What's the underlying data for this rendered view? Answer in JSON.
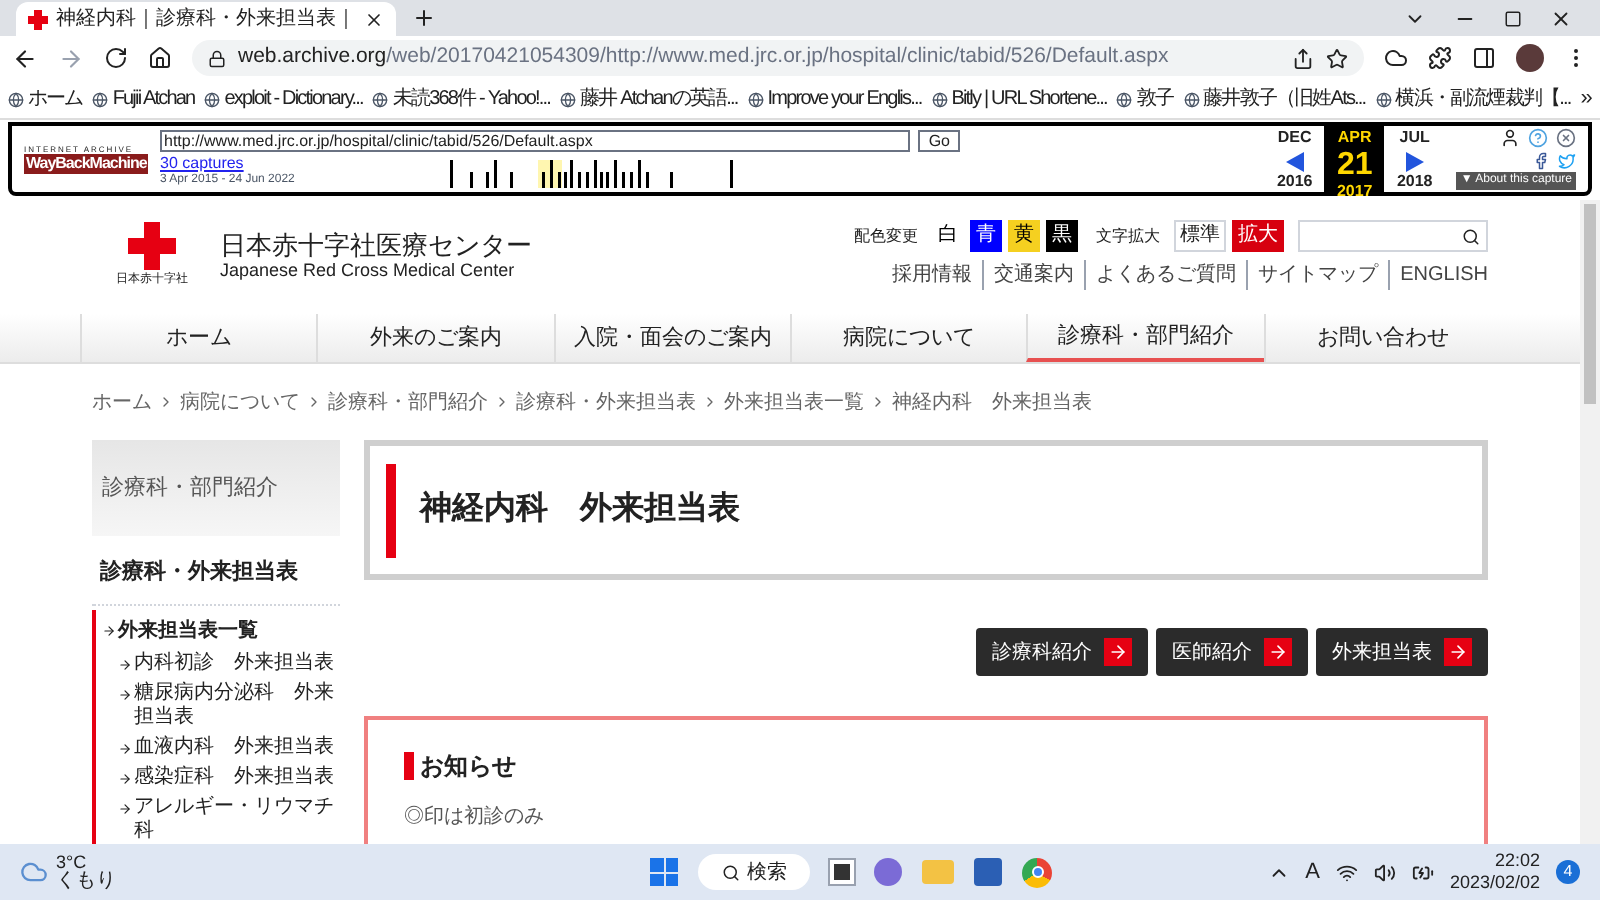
{
  "browser": {
    "tab_title": "神経内科｜診療科・外来担当表｜",
    "url_host": "web.archive.org",
    "url_path": "/web/20170421054309/http://www.med.jrc.or.jp/hospital/clinic/tabid/526/Default.aspx",
    "bookmarks": [
      "ホーム",
      "Fujii Atchan",
      "exploit - Dictionary...",
      "未読368件 - Yahoo!...",
      "藤井 Atchanの英語...",
      "Improve your Englis...",
      "Bitly | URL Shortene...",
      "敦子",
      "藤井敦子（旧姓Ats...",
      "横浜・副流煙裁判【..."
    ],
    "more": "»"
  },
  "wayback": {
    "logo_top": "INTERNET ARCHIVE",
    "logo": "WayBackMachine",
    "url": "http://www.med.jrc.or.jp/hospital/clinic/tabid/526/Default.aspx",
    "go": "Go",
    "captures": "30 captures",
    "range": "3 Apr 2015 - 24 Jun 2022",
    "months": [
      {
        "month": "DEC",
        "year": "2016",
        "selected": false
      },
      {
        "month": "APR",
        "day": "21",
        "year": "2017",
        "selected": true
      },
      {
        "month": "JUL",
        "year": "2018",
        "selected": false
      }
    ],
    "about": "▼ About this capture"
  },
  "site": {
    "logo_sub": "日本赤十字社",
    "name": "日本赤十字社医療センター",
    "name_en": "Japanese Red Cross Medical Center",
    "color_label": "配色変更",
    "color_options": [
      {
        "label": "白",
        "color": "#ffffff"
      },
      {
        "label": "青",
        "color": "#0000ff"
      },
      {
        "label": "黄",
        "color": "#f5d020"
      },
      {
        "label": "黒",
        "color": "#000000"
      }
    ],
    "size_label": "文字拡大",
    "size_options": [
      {
        "label": "標準",
        "selected": false
      },
      {
        "label": "拡大",
        "selected": true
      }
    ],
    "links": [
      "採用情報",
      "交通案内",
      "よくあるご質問",
      "サイトマップ",
      "ENGLISH"
    ],
    "nav": [
      {
        "label": "ホーム",
        "selected": false
      },
      {
        "label": "外来のご案内",
        "selected": false
      },
      {
        "label": "入院・面会のご案内",
        "selected": false
      },
      {
        "label": "病院について",
        "selected": false
      },
      {
        "label": "診療科・部門紹介",
        "selected": true
      },
      {
        "label": "お問い合わせ",
        "selected": false
      }
    ],
    "breadcrumb": [
      "ホーム",
      "病院について",
      "診療科・部門紹介",
      "診療科・外来担当表",
      "外来担当表一覧",
      "神経内科　外来担当表"
    ]
  },
  "sidebar": {
    "heading": "診療科・部門紹介",
    "subheading": "診療科・外来担当表",
    "items": [
      {
        "label": "外来担当表一覧",
        "children": [
          {
            "label": "内科初診　外来担当表"
          },
          {
            "label": "糖尿病内分泌科　外来担当表"
          },
          {
            "label": "血液内科　外来担当表"
          },
          {
            "label": "感染症科　外来担当表"
          },
          {
            "label": "アレルギー・リウマチ科"
          }
        ]
      }
    ]
  },
  "main": {
    "title": "神経内科　外来担当表",
    "buttons": [
      "診療科紹介",
      "医師紹介",
      "外来担当表"
    ],
    "notice_title": "お知らせ",
    "notice_text": "◎印は初診のみ"
  },
  "taskbar": {
    "input_mode": "A",
    "temp": "3°C",
    "weather": "くもり",
    "search": "検索",
    "time": "22:02",
    "date": "2023/02/02",
    "badge": "4"
  }
}
